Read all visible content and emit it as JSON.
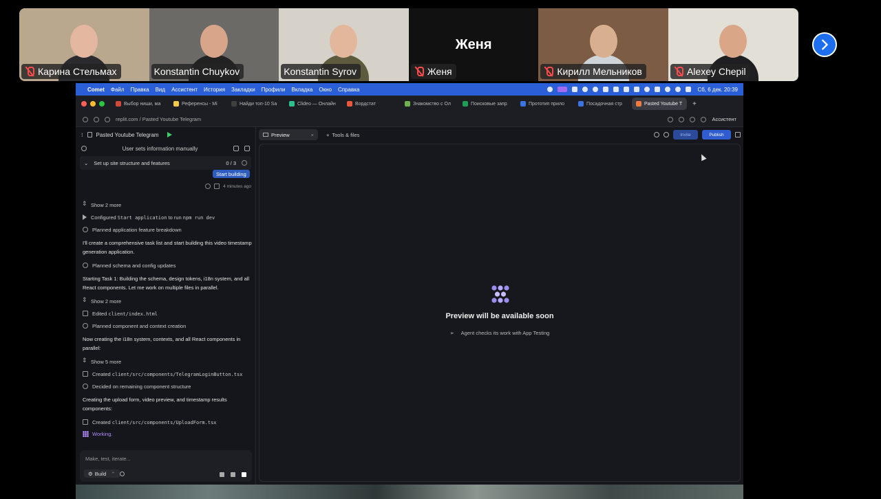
{
  "participants": [
    {
      "name": "Карина Стельмах",
      "muted": true,
      "bg": "#b9a78e",
      "skin": "#e4b8a0",
      "shirt": "#2b2b2e"
    },
    {
      "name": "Konstantin Chuykov",
      "muted": false,
      "bg": "#6b6a66",
      "skin": "#d8a58a",
      "shirt": "#222"
    },
    {
      "name": "Konstantin Syrov",
      "muted": false,
      "bg": "#d7d2c9",
      "skin": "#e2b79c",
      "shirt": "#5d5a3e",
      "active": true
    },
    {
      "name": "Женя",
      "muted": true,
      "bg": "#111",
      "placeholder": "Женя"
    },
    {
      "name": "Кирилл Мельников",
      "muted": true,
      "bg": "#7d5c45",
      "skin": "#d8b08f",
      "shirt": "#cfd4d8"
    },
    {
      "name": "Alexey Chepil",
      "muted": true,
      "bg": "#e2dfd6",
      "skin": "#d9a688",
      "shirt": "#1f1f22"
    }
  ],
  "menubar": {
    "app": "Comet",
    "items": [
      "Файл",
      "Правка",
      "Вид",
      "Ассистент",
      "История",
      "Закладки",
      "Профили",
      "Вкладка",
      "Окно",
      "Справка"
    ],
    "clock": "Сб, 6 дек.  20:39"
  },
  "tabs": [
    {
      "label": "Выбор ниши, ма",
      "color": "#d04a3a"
    },
    {
      "label": "Референсы - Mi",
      "color": "#f2c94c"
    },
    {
      "label": "Найди топ-10 Sa",
      "color": "#3f3f3f"
    },
    {
      "label": "Clideo — Онлайн",
      "color": "#2fbf8f"
    },
    {
      "label": "Вордстат",
      "color": "#e8573e"
    },
    {
      "label": "Знакомство с Ол",
      "color": "#6fb34d"
    },
    {
      "label": "Поисковые запр",
      "color": "#1e9e54"
    },
    {
      "label": "Прототип прило",
      "color": "#3b74e0"
    },
    {
      "label": "Посадочная стр",
      "color": "#3b74e0"
    },
    {
      "label": "Pasted Youtube T",
      "color": "#f07b3f",
      "active": true
    }
  ],
  "address": {
    "url": "replit.com / Pasted Youtube Telegram",
    "assistant": "Ассистент"
  },
  "left_panel": {
    "project": "Pasted Youtube Telegram",
    "subtitle": "User sets information manually",
    "task": "Set up site structure and features",
    "task_count": "0 / 3",
    "start_button": "Start building",
    "timestamp": "4 minutes ago",
    "feed": [
      {
        "kind": "item",
        "icon": "updown",
        "text": "Show 2 more"
      },
      {
        "kind": "item",
        "icon": "arrow",
        "text": "Configured ",
        "mono": "Start application",
        "tail": " to run ",
        "mono2": "npm run dev"
      },
      {
        "kind": "item",
        "icon": "circle",
        "text": "Planned application feature breakdown"
      },
      {
        "kind": "para",
        "text": "I'll create a comprehensive task list and start building this video timestamp generation application."
      },
      {
        "kind": "item",
        "icon": "circle",
        "text": "Planned schema and config updates"
      },
      {
        "kind": "para",
        "text": "Starting Task 1: Building the schema, design tokens, i18n system, and all React components. Let me work on multiple files in parallel."
      },
      {
        "kind": "item",
        "icon": "updown",
        "text": "Show 2 more"
      },
      {
        "kind": "item",
        "icon": "sq",
        "text": "Edited ",
        "mono": "client/index.html"
      },
      {
        "kind": "item",
        "icon": "circle",
        "text": "Planned component and context creation"
      },
      {
        "kind": "para",
        "text": "Now creating the i18n system, contexts, and all React components in parallel:"
      },
      {
        "kind": "item",
        "icon": "updown",
        "text": "Show 5 more"
      },
      {
        "kind": "item",
        "icon": "sq",
        "text": "Created ",
        "mono": "client/src/components/TelegramLoginButton.tsx"
      },
      {
        "kind": "item",
        "icon": "circle",
        "text": "Decided on remaining component structure"
      },
      {
        "kind": "para",
        "text": "Creating the upload form, video preview, and timestamp results components:"
      },
      {
        "kind": "item",
        "icon": "sq",
        "text": "Created ",
        "mono": "client/src/components/UploadForm.tsx"
      },
      {
        "kind": "working",
        "text": "Working."
      }
    ],
    "input_placeholder": "Make, test, iterate...",
    "build_label": "Build"
  },
  "right_panel": {
    "tab_preview": "Preview",
    "tab_tools": "Tools & files",
    "invite": "Invite",
    "publish": "Publish",
    "preview_title": "Preview will be available soon",
    "preview_sub": "Agent checks its work with App Testing"
  },
  "icons": {
    "next": "chevron-right-icon",
    "mic": "mic-off-icon",
    "logo": "replit-agent-logo-icon"
  },
  "colors": {
    "active_speaker": "#3ad17a",
    "muted": "#ff4b4b",
    "accent": "#2f5dd0",
    "working": "#b48bff"
  }
}
